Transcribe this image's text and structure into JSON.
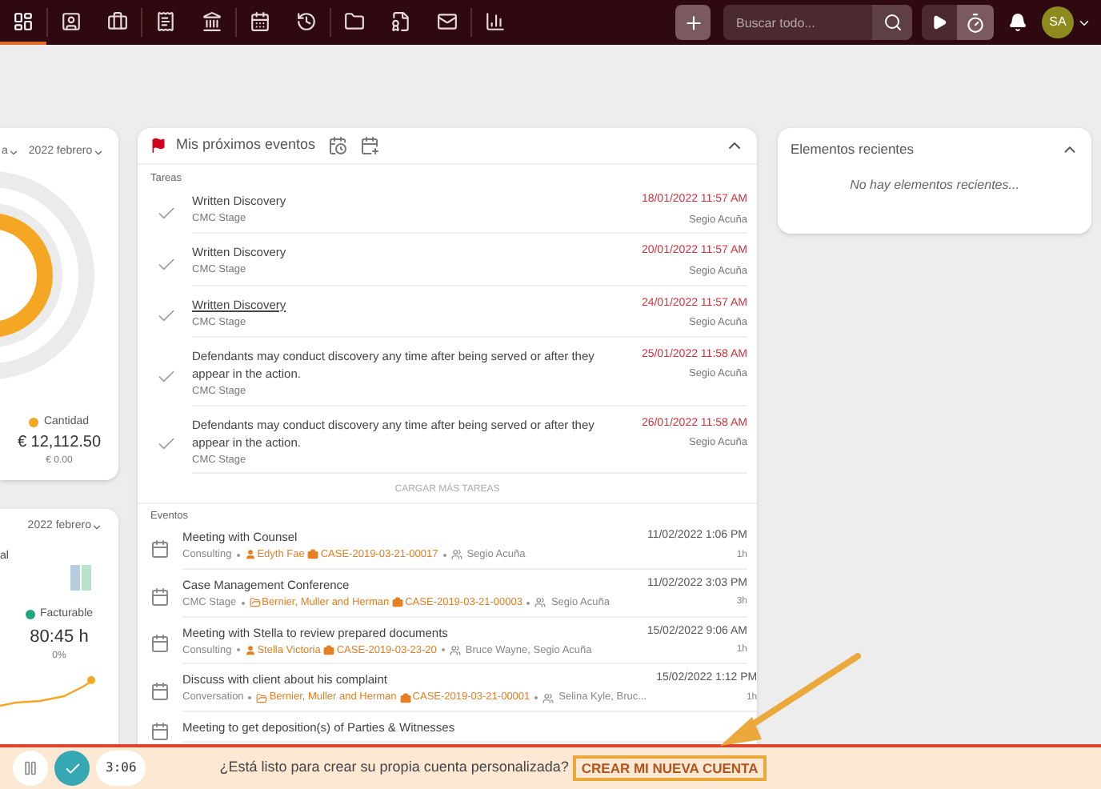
{
  "topbar": {
    "nav_items": [
      {
        "kind": "dashboard",
        "selected": true
      },
      {
        "kind": "contacts",
        "selected": false
      },
      {
        "kind": "cases",
        "selected": false
      },
      {
        "kind": "billing",
        "selected": false
      },
      {
        "kind": "bank",
        "selected": false
      },
      {
        "kind": "calendar",
        "selected": false
      },
      {
        "kind": "history",
        "selected": false
      },
      {
        "kind": "documents",
        "selected": false
      },
      {
        "kind": "templates",
        "selected": false
      },
      {
        "kind": "mail",
        "selected": false
      },
      {
        "kind": "reports",
        "selected": false
      }
    ],
    "search": {
      "placeholder": "Buscar todo..."
    },
    "avatar": "SA"
  },
  "left_cards": [
    {
      "filter": "a",
      "period": "2022 febrero",
      "legend": "Cantidad",
      "color": "#f5a623",
      "amount": "€ 12,112.50",
      "sub_amount": "€ 0.00"
    },
    {
      "period": "2022 febrero",
      "label": "al",
      "legend": "Facturable",
      "color": "#1fa67a",
      "amount": "80:45 h",
      "sub_amount": "0%"
    }
  ],
  "events_card": {
    "title": "Mis próximos eventos",
    "tasks_label": "Tareas",
    "tasks": [
      {
        "title": "Written Discovery",
        "underlined": false,
        "stage": "CMC Stage",
        "date": "18/01/2022 11:57 AM",
        "assignee": "Segio Acuña"
      },
      {
        "title": "Written Discovery",
        "underlined": false,
        "stage": "CMC Stage",
        "date": "20/01/2022 11:57 AM",
        "assignee": "Segio Acuña"
      },
      {
        "title": "Written Discovery",
        "underlined": true,
        "stage": "CMC Stage",
        "date": "24/01/2022 11:57 AM",
        "assignee": "Segio Acuña"
      },
      {
        "title": "Defendants may conduct discovery any time after being served or after they appear in the action.",
        "underlined": false,
        "stage": "CMC Stage",
        "date": "25/01/2022 11:58 AM",
        "assignee": "Segio Acuña"
      },
      {
        "title": "Defendants may conduct discovery any time after being served or after they appear in the action.",
        "underlined": false,
        "stage": "CMC Stage",
        "date": "26/01/2022 11:58 AM",
        "assignee": "Segio Acuña"
      }
    ],
    "load_more": "CARGAR MÁS TAREAS",
    "events_label": "Eventos",
    "events": [
      {
        "title": "Meeting with Counsel",
        "type": "Consulting",
        "kind": "person",
        "contact": "Edyth Fae",
        "case": "CASE-2019-03-21-00017",
        "people": "Segio Acuña",
        "date": "11/02/2022 1:06 PM",
        "duration": "1h"
      },
      {
        "title": "Case Management Conference",
        "type": "CMC Stage",
        "kind": "company",
        "contact": "Bernier, Muller and Herman",
        "case": "CASE-2019-03-21-00003",
        "people": "Segio Acuña",
        "date": "11/02/2022 3:03 PM",
        "duration": "3h"
      },
      {
        "title": "Meeting with Stella to review prepared documents",
        "type": "Consulting",
        "kind": "person",
        "contact": "Stella Victoria",
        "case": "CASE-2019-03-23-20",
        "people": "Bruce Wayne, Segio Acuña",
        "date": "15/02/2022 9:06 AM",
        "duration": "1h"
      },
      {
        "title": "Discuss with client about his complaint",
        "type": "Conversation",
        "kind": "company",
        "contact": "Bernier, Muller and Herman",
        "case": "CASE-2019-03-21-00001",
        "people": "Selina Kyle, Bruc...",
        "date": "15/02/2022 1:12 PM",
        "duration": "1h"
      },
      {
        "title": "Meeting to get deposition(s) of Parties & Witnesses"
      }
    ]
  },
  "recent_card": {
    "title": "Elementos recientes",
    "empty": "No hay elementos recientes..."
  },
  "banner": {
    "player_time": "3:06",
    "question": "¿Está listo para crear su propia cuenta personalizada?",
    "cta": "CREAR MI NUEVA CUENTA"
  }
}
